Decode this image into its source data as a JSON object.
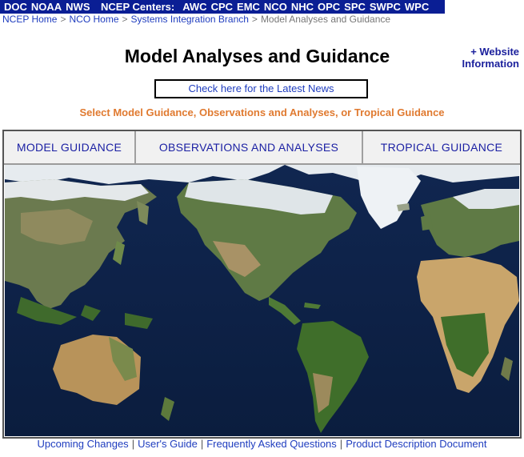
{
  "topbar": {
    "agency_links": [
      "DOC",
      "NOAA",
      "NWS"
    ],
    "centers_label": "NCEP Centers:",
    "center_links": [
      "AWC",
      "CPC",
      "EMC",
      "NCO",
      "NHC",
      "OPC",
      "SPC",
      "SWPC",
      "WPC"
    ],
    "bar_color": "#0a1e94"
  },
  "breadcrumb": {
    "items": [
      "NCEP Home",
      "NCO Home",
      "Systems Integration Branch"
    ],
    "current": "Model Analyses and Guidance",
    "separator": ">"
  },
  "page_title": "Model Analyses and Guidance",
  "site_info": {
    "line1": "+ Website",
    "line2": "Information"
  },
  "news_link": "Check here for the Latest News",
  "select_prompt": "Select Model Guidance, Observations and Analyses, or Tropical Guidance",
  "tabs": [
    "MODEL GUIDANCE",
    "OBSERVATIONS AND ANALYSES",
    "TROPICAL GUIDANCE"
  ],
  "map": {
    "icon": "world-map-image"
  },
  "footer_links": [
    "Upcoming Changes",
    "User's Guide",
    "Frequently Asked Questions",
    "Product Description Document"
  ],
  "colors": {
    "link": "#1f3dbf",
    "prompt": "#e07a30",
    "ocean": "#0d2346"
  }
}
